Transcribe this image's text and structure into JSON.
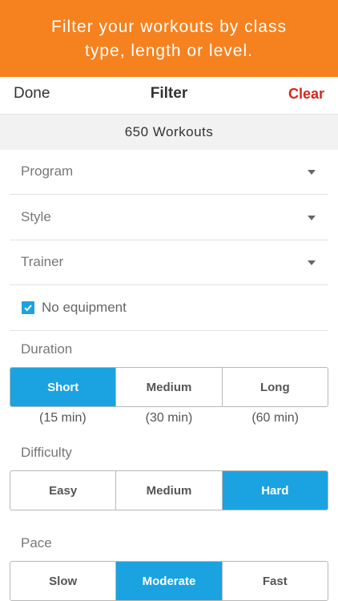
{
  "banner": {
    "text": "Filter your workouts by class type, length or level.",
    "color": "#f5821f"
  },
  "navbar": {
    "done_label": "Done",
    "title": "Filter",
    "clear_label": "Clear",
    "clear_color": "#d9261c"
  },
  "summary": {
    "count_text": "650 Workouts"
  },
  "selects": {
    "program": "Program",
    "style": "Style",
    "trainer": "Trainer"
  },
  "equipment": {
    "label": "No equipment",
    "checked": true
  },
  "duration": {
    "label": "Duration",
    "options": [
      "Short",
      "Medium",
      "Long"
    ],
    "selected": "Short",
    "hints": [
      "(15 min)",
      "(30 min)",
      "(60 min)"
    ]
  },
  "difficulty": {
    "label": "Difficulty",
    "options": [
      "Easy",
      "Medium",
      "Hard"
    ],
    "selected": "Hard"
  },
  "pace": {
    "label": "Pace",
    "options": [
      "Slow",
      "Moderate",
      "Fast"
    ],
    "selected": "Moderate"
  },
  "accent_color": "#1aa3e0",
  "icons": {
    "dropdown": "chevron-down-icon",
    "check": "checkmark-icon"
  }
}
